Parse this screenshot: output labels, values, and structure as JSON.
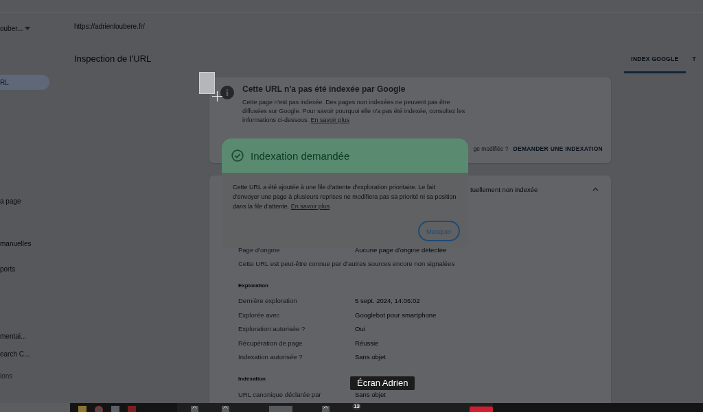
{
  "sidebar": {
    "property": "ouber...",
    "items": [
      {
        "label": "RL",
        "selected": true,
        "kind": "nav"
      },
      {
        "label": "a page",
        "selected": false,
        "kind": "nav"
      },
      {
        "label": "manuelles",
        "selected": false,
        "kind": "nav"
      },
      {
        "label": "ports",
        "selected": false,
        "kind": "nav"
      },
      {
        "label": "mentai...",
        "selected": false,
        "kind": "nav"
      },
      {
        "label": "earch C...",
        "selected": false,
        "kind": "nav"
      },
      {
        "label": "ions",
        "selected": false,
        "kind": "footer"
      }
    ]
  },
  "url": "https://adrienloubere.fr/",
  "page_title": "Inspection de l'URL",
  "tabs": [
    {
      "label": "INDEX GOOGLE",
      "selected": true
    },
    {
      "label": "T",
      "selected": false
    }
  ],
  "status_card": {
    "title": "Cette URL n'a pas été indexée par Google",
    "text": "Cette page n'est pas indexée. Des pages non indexées ne peuvent pas être diffusées sur Google. Pour savoir pourquoi elle n'a pas été indexée, consultez les informations ci-dessous.",
    "link": "En savoir plus",
    "question": "ge modifiée ?",
    "button": "DEMANDER UNE INDEXATION"
  },
  "details_card": {
    "header": "tuellement non indexée",
    "expanded": true,
    "rows": [
      {
        "kind": "pair",
        "label": "Page d'origine",
        "value": "Aucune page d'origine détectée"
      },
      {
        "kind": "note",
        "text": "Cette URL est peut-être connue par d'autres sources encore non signalées"
      },
      {
        "kind": "heading",
        "text": "Exploration"
      },
      {
        "kind": "pair",
        "label": "Dernière exploration",
        "value": "5 sept. 2024, 14:06:02"
      },
      {
        "kind": "pair",
        "label": "Explorée avec",
        "value": "Googlebot pour smartphone"
      },
      {
        "kind": "pair",
        "label": "Exploration autorisée ?",
        "value": "Oui"
      },
      {
        "kind": "pair",
        "label": "Récupération de page",
        "value": "Réussie"
      },
      {
        "kind": "pair",
        "label": "Indexation autorisée ?",
        "value": "Sans objet"
      },
      {
        "kind": "heading",
        "text": "Indexation"
      },
      {
        "kind": "pair",
        "label": "URL canonique déclarée par",
        "value": "Sans objet"
      }
    ]
  },
  "dialog": {
    "title": "Indexation demandée",
    "text": "Cette URL a été ajoutée à une file d'attente d'exploration prioritaire. Le fait d'envoyer une page à plusieurs reprises ne modifiera pas sa priorité ni sa position dans la file d'attente.",
    "link": "En savoir plus",
    "button": "Masquer"
  },
  "tooltip": "Écran Adrien",
  "share_bar": {
    "badge": "13"
  }
}
